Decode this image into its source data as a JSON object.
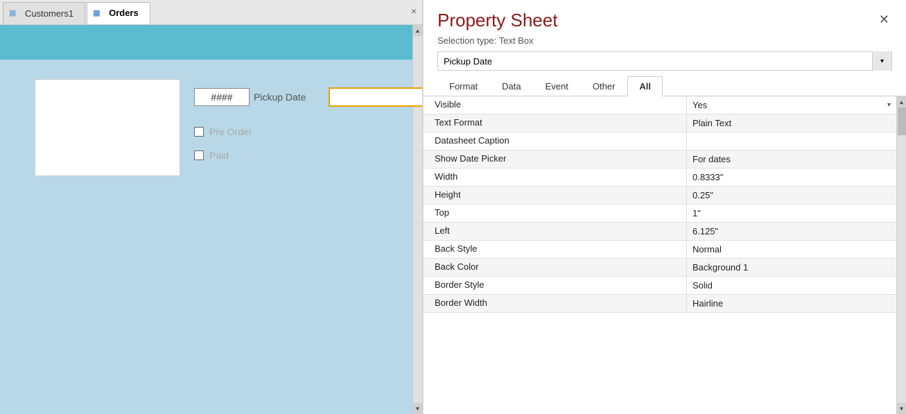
{
  "tabs": [
    {
      "id": "customers1",
      "label": "Customers1",
      "active": false
    },
    {
      "id": "orders",
      "label": "Orders",
      "active": true
    }
  ],
  "tab_close": "×",
  "form": {
    "hash_label": "####",
    "pickup_date_label": "Pickup Date",
    "pre_order_label": "Pre Order",
    "paid_label": "Paid"
  },
  "property_sheet": {
    "title": "Property Sheet",
    "close_btn": "✕",
    "selection_type": "Selection type: Text Box",
    "dropdown_value": "Pickup Date",
    "tabs": [
      {
        "id": "format",
        "label": "Format",
        "active": false
      },
      {
        "id": "data",
        "label": "Data",
        "active": false
      },
      {
        "id": "event",
        "label": "Event",
        "active": false
      },
      {
        "id": "other",
        "label": "Other",
        "active": false
      },
      {
        "id": "all",
        "label": "All",
        "active": true
      }
    ],
    "properties": [
      {
        "key": "Visible",
        "value": "Yes",
        "has_dropdown": true
      },
      {
        "key": "Text Format",
        "value": "Plain Text",
        "has_dropdown": false
      },
      {
        "key": "Datasheet Caption",
        "value": "",
        "has_dropdown": false
      },
      {
        "key": "Show Date Picker",
        "value": "For dates",
        "has_dropdown": false
      },
      {
        "key": "Width",
        "value": "0.8333\"",
        "has_dropdown": false
      },
      {
        "key": "Height",
        "value": "0.25\"",
        "has_dropdown": false
      },
      {
        "key": "Top",
        "value": "1\"",
        "has_dropdown": false
      },
      {
        "key": "Left",
        "value": "6.125\"",
        "has_dropdown": false
      },
      {
        "key": "Back Style",
        "value": "Normal",
        "has_dropdown": false
      },
      {
        "key": "Back Color",
        "value": "Background 1",
        "has_dropdown": false
      },
      {
        "key": "Border Style",
        "value": "Solid",
        "has_dropdown": false
      },
      {
        "key": "Border Width",
        "value": "Hairline",
        "has_dropdown": false
      }
    ]
  },
  "icons": {
    "tab_icon": "▦",
    "chevron_down": "▾",
    "scroll_up": "▲",
    "scroll_down": "▼"
  }
}
